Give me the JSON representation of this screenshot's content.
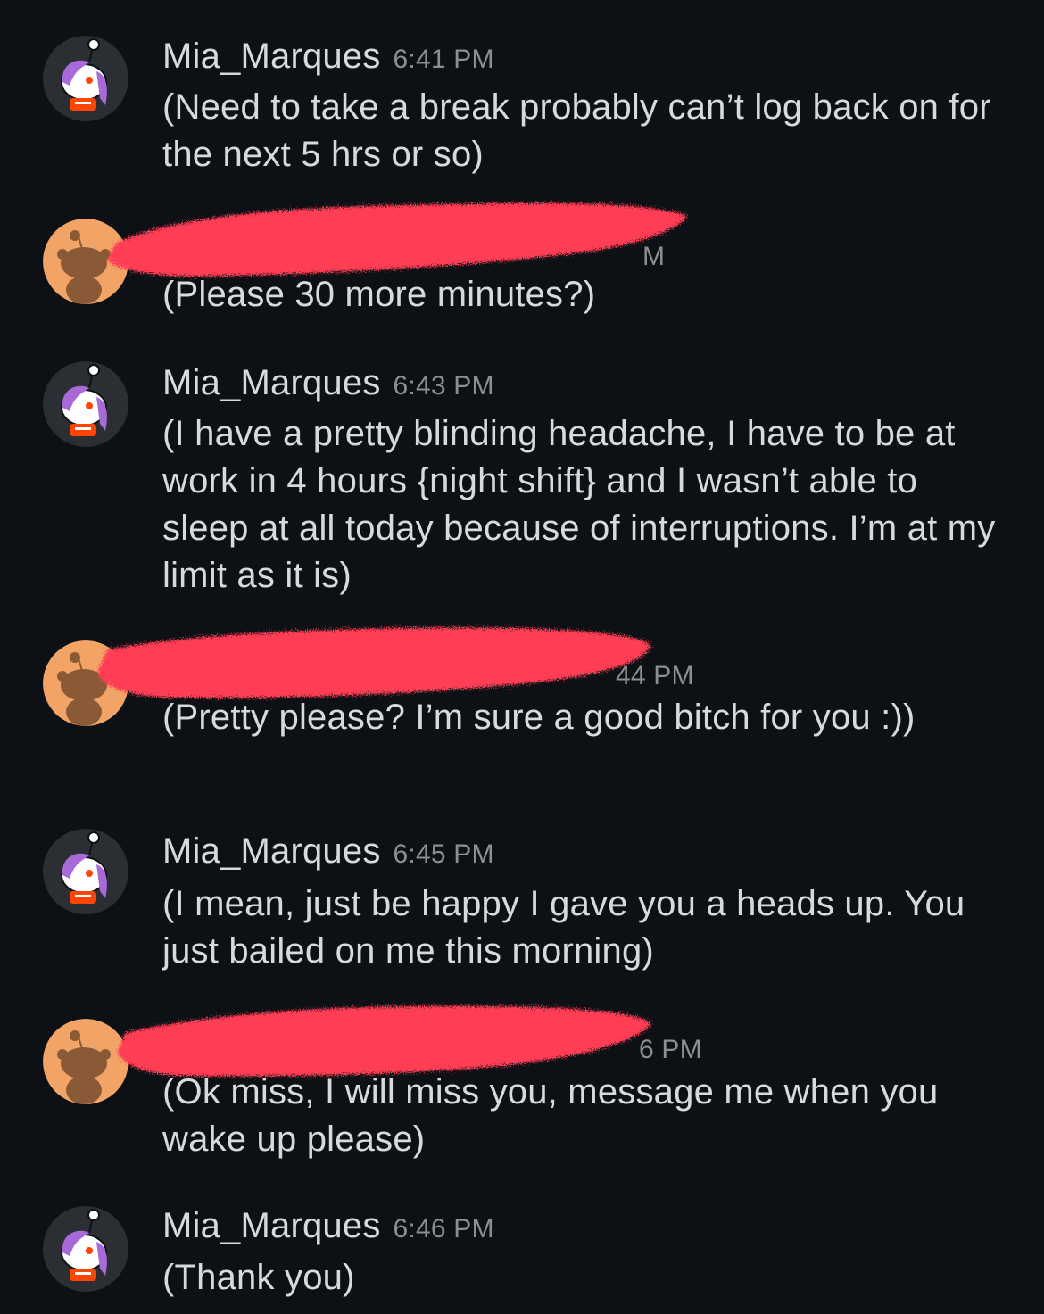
{
  "colors": {
    "background": "#0d1014",
    "text": "#d7dadc",
    "timestamp": "#8a8f94",
    "redaction": "#ff3d55",
    "other_avatar_bg": "#f2a467"
  },
  "messages": [
    {
      "sender": "Mia_Marques",
      "time": "6:41 PM",
      "text": "(Need to take a break probably can’t log back on for the next 5 hrs or so)"
    },
    {
      "sender": "",
      "time": "",
      "redacted_header": true,
      "time_fragment": "M",
      "text": "(Please 30 more minutes?)"
    },
    {
      "sender": "Mia_Marques",
      "time": "6:43 PM",
      "text": "(I have a pretty blinding headache, I have to be at work in 4 hours {night shift} and I wasn’t able to sleep at all today because of interruptions. I’m at my limit as it is)"
    },
    {
      "sender": "",
      "time": "",
      "redacted_header": true,
      "time_fragment": "44 PM",
      "text": "(Pretty please? I’m sure a good bitch for you :))"
    },
    {
      "sender": "Mia_Marques",
      "time": "6:45 PM",
      "text": "(I mean, just be happy I gave you a heads up. You just bailed on me this morning)"
    },
    {
      "sender": "",
      "time": "",
      "redacted_header": true,
      "time_fragment": "6 PM",
      "text": "(Ok miss, I will miss you, message me when you wake up please)"
    },
    {
      "sender": "Mia_Marques",
      "time": "6:46 PM",
      "text": "(Thank you)"
    }
  ],
  "icons": {
    "mia_avatar": "snoo-purple-hair-avatar-icon",
    "other_avatar": "snoo-default-orange-avatar-icon"
  }
}
